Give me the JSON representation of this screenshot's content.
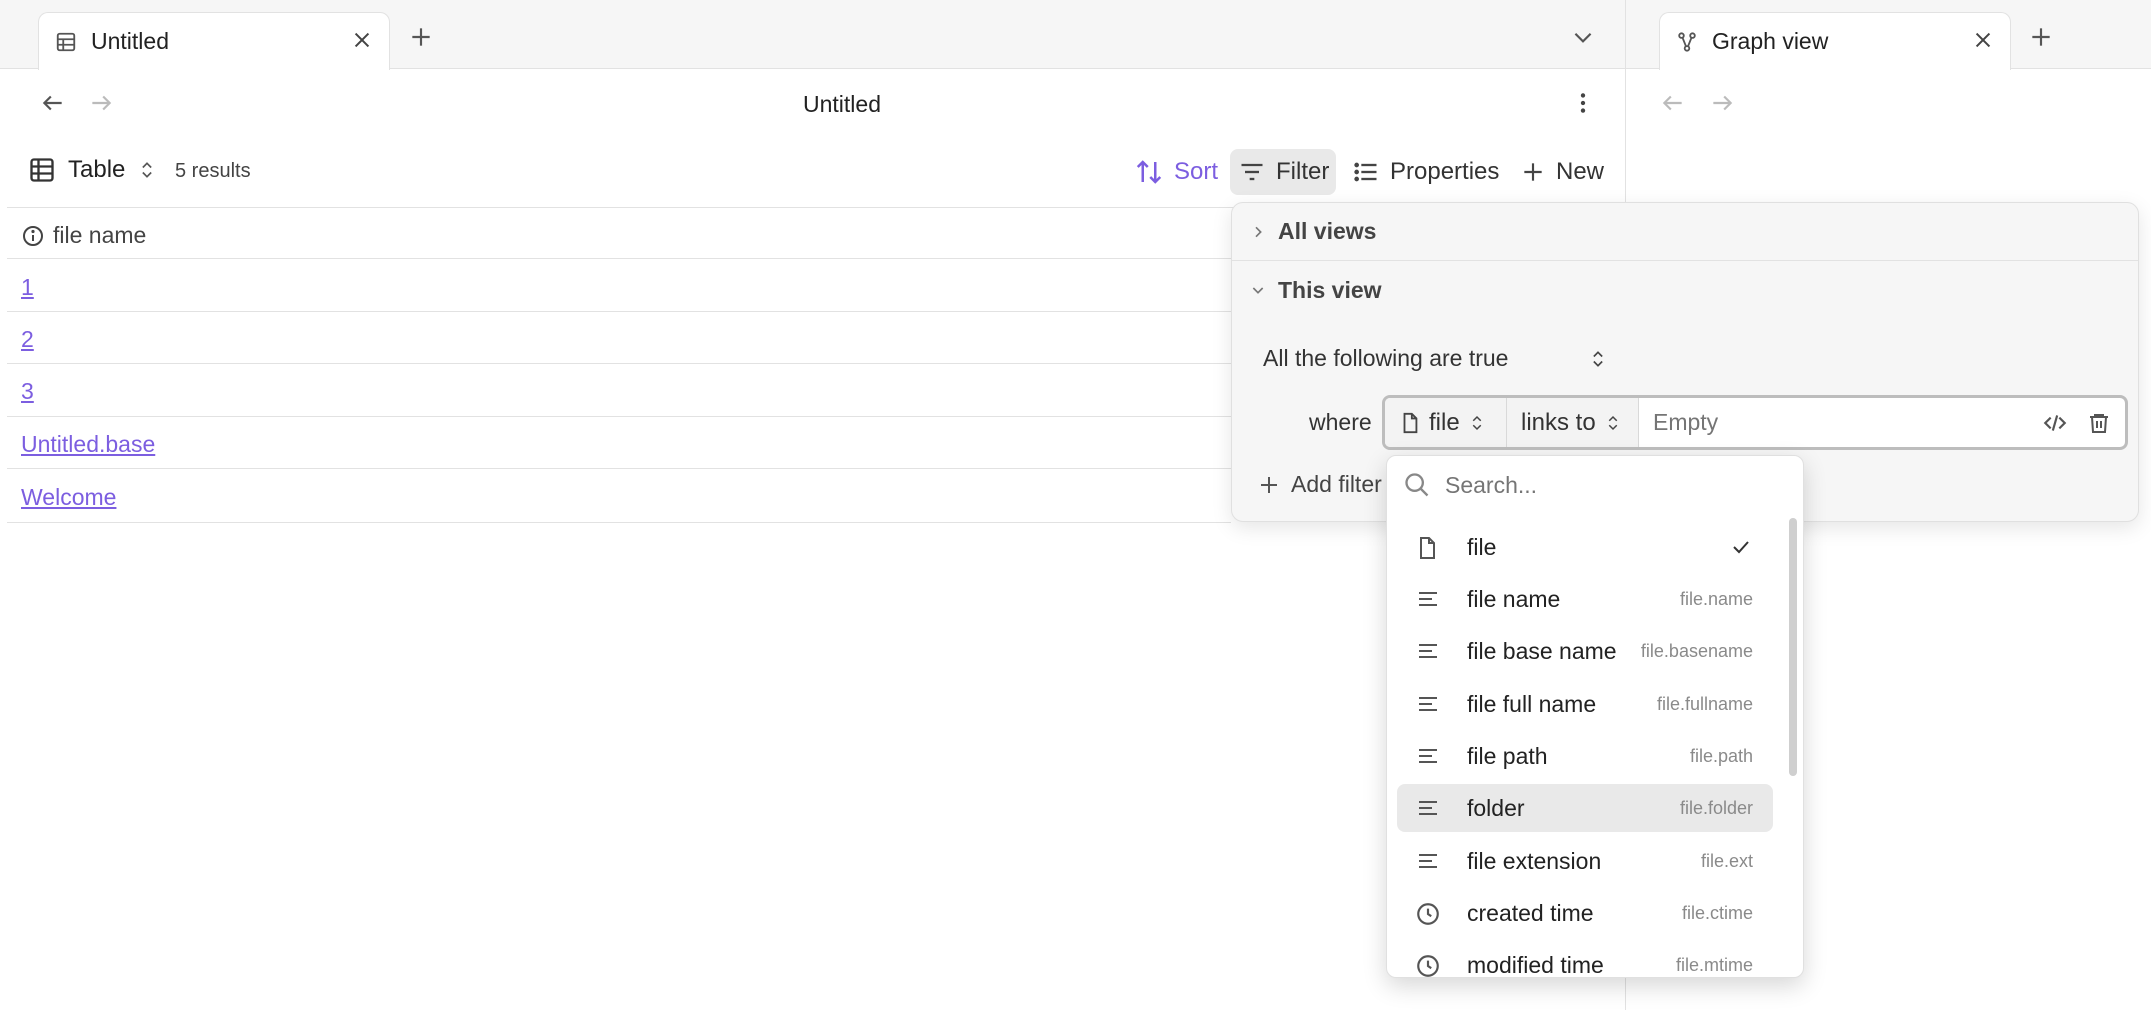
{
  "left_pane": {
    "tab_title": "Untitled",
    "page_title": "Untitled",
    "view_name": "Table",
    "result_count": "5 results",
    "toolbar": {
      "sort": "Sort",
      "filter": "Filter",
      "properties": "Properties",
      "new": "New"
    },
    "table": {
      "column_header": "file name",
      "rows": [
        "1",
        "2",
        "3",
        "Untitled.base",
        "Welcome"
      ]
    }
  },
  "right_pane": {
    "tab_title": "Graph view"
  },
  "filter_panel": {
    "all_views": "All views",
    "this_view": "This view",
    "condition": "All the following are true",
    "where": "where",
    "property": "file",
    "operator": "links to",
    "value_placeholder": "Empty",
    "add_filter": "Add filter"
  },
  "property_dropdown": {
    "search_placeholder": "Search...",
    "items": [
      {
        "label": "file",
        "key": "",
        "icon": "file-icon",
        "checked": true
      },
      {
        "label": "file name",
        "key": "file.name",
        "icon": "text-icon"
      },
      {
        "label": "file base name",
        "key": "file.basename",
        "icon": "text-icon"
      },
      {
        "label": "file full name",
        "key": "file.fullname",
        "icon": "text-icon"
      },
      {
        "label": "file path",
        "key": "file.path",
        "icon": "text-icon"
      },
      {
        "label": "folder",
        "key": "file.folder",
        "icon": "text-icon",
        "highlighted": true
      },
      {
        "label": "file extension",
        "key": "file.ext",
        "icon": "text-icon"
      },
      {
        "label": "created time",
        "key": "file.ctime",
        "icon": "clock-icon"
      },
      {
        "label": "modified time",
        "key": "file.mtime",
        "icon": "clock-icon"
      }
    ]
  },
  "colors": {
    "accent": "#7c5ee0",
    "highlight": "#e9e9e9"
  }
}
